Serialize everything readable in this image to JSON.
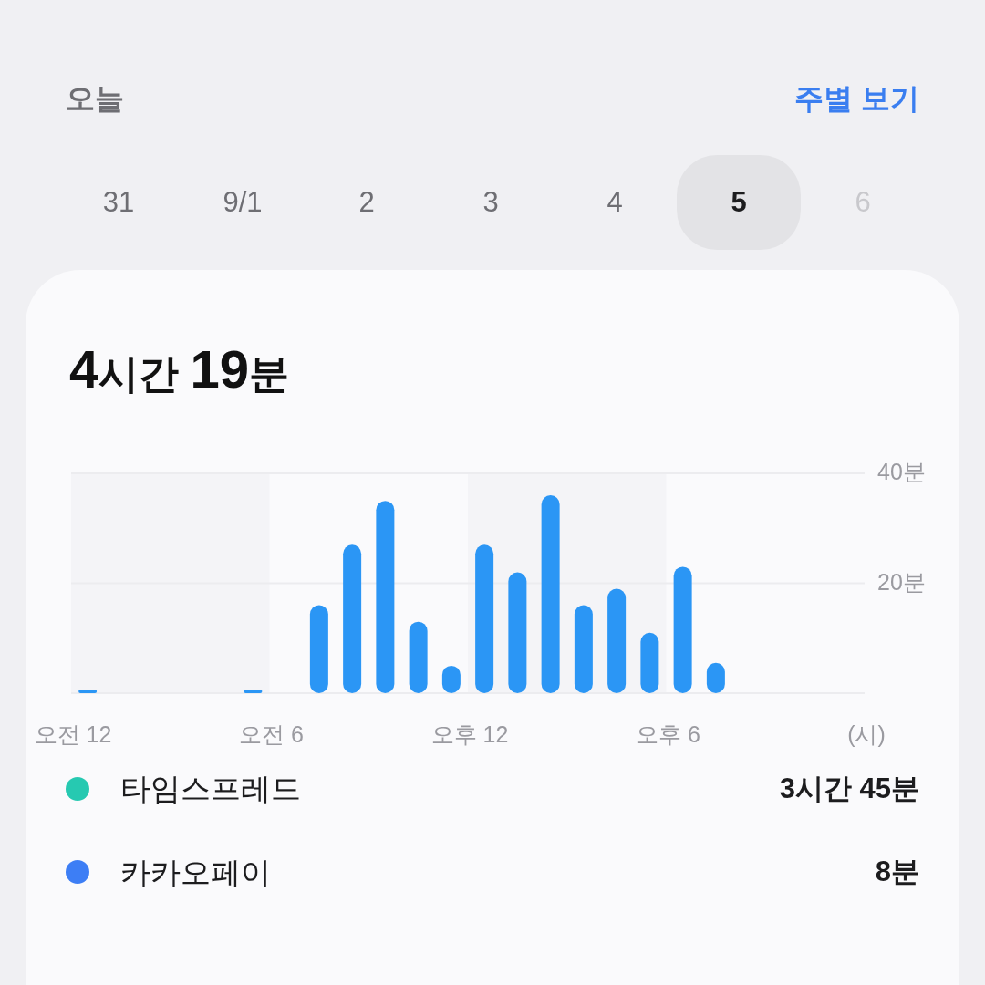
{
  "header": {
    "title": "오늘",
    "link": "주별 보기"
  },
  "days": [
    {
      "label": "31",
      "selected": false,
      "disabled": false
    },
    {
      "label": "9/1",
      "selected": false,
      "disabled": false
    },
    {
      "label": "2",
      "selected": false,
      "disabled": false
    },
    {
      "label": "3",
      "selected": false,
      "disabled": false
    },
    {
      "label": "4",
      "selected": false,
      "disabled": false
    },
    {
      "label": "5",
      "selected": true,
      "disabled": false
    },
    {
      "label": "6",
      "selected": false,
      "disabled": true
    }
  ],
  "summary": {
    "total": "4시간 19분",
    "chart_data": {
      "type": "bar",
      "xlabel": "(시)",
      "categories": [
        "오전 12",
        null,
        null,
        null,
        null,
        null,
        "오전 6",
        null,
        null,
        null,
        null,
        null,
        "오후 12",
        null,
        null,
        null,
        null,
        null,
        "오후 6",
        null,
        null,
        null,
        null,
        null
      ],
      "series": [
        {
          "color": "#2b96f5",
          "values": [
            0.5,
            0,
            0,
            0,
            0,
            0.5,
            0,
            16,
            27,
            35,
            13,
            5,
            27,
            22,
            36,
            16,
            19,
            11,
            23,
            5.5,
            0,
            0,
            0,
            0
          ]
        }
      ],
      "ylim": [
        0,
        40
      ],
      "yticks": [
        {
          "value": 20,
          "label": "20분"
        },
        {
          "value": 40,
          "label": "40분"
        }
      ]
    }
  },
  "apps": [
    {
      "name": "타임스프레드",
      "duration": "3시간 45분",
      "color": "#26c9b1"
    },
    {
      "name": "카카오페이",
      "duration": "8분",
      "color": "#3d7ef5"
    }
  ]
}
